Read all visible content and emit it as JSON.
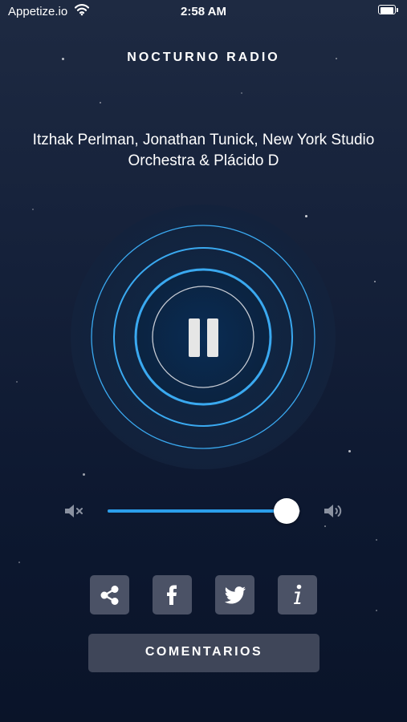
{
  "status_bar": {
    "carrier": "Appetize.io",
    "time": "2:58 AM"
  },
  "station": {
    "name": "NOCTURNO RADIO"
  },
  "now_playing": {
    "title": "Itzhak Perlman, Jonathan Tunick, New York Studio Orchestra & Plácido D"
  },
  "player": {
    "state": "playing",
    "control_icon": "pause-icon"
  },
  "volume": {
    "level": 0.93,
    "min_icon": "volume-mute-icon",
    "max_icon": "volume-max-icon"
  },
  "share": {
    "buttons": [
      {
        "name": "share",
        "icon": "share-icon"
      },
      {
        "name": "facebook",
        "icon": "facebook-icon"
      },
      {
        "name": "twitter",
        "icon": "twitter-icon"
      },
      {
        "name": "info",
        "icon": "info-icon"
      }
    ]
  },
  "comments": {
    "label": "COMENTARIOS"
  },
  "colors": {
    "accent": "#2b9eea",
    "ring": "#3aa9f0",
    "button_bg": "#4b5266",
    "background_top": "#1e2a42",
    "background_bottom": "#0a1429"
  }
}
